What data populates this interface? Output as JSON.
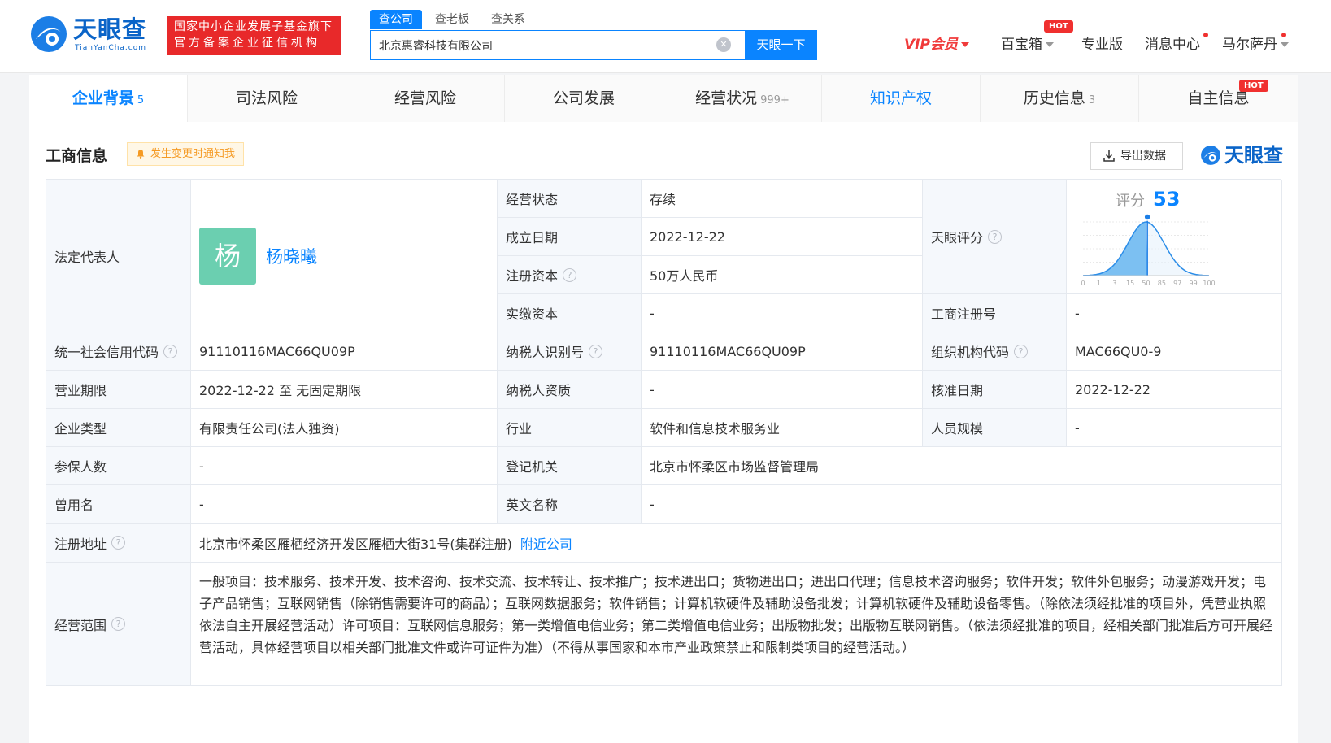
{
  "header": {
    "logo_name": "天眼查",
    "logo_domain": "TianYanCha.com",
    "gov_line1": "国家中小企业发展子基金旗下",
    "gov_line2": "官方备案企业征信机构",
    "search_tabs": [
      "查公司",
      "查老板",
      "查关系"
    ],
    "search_value": "北京惠睿科技有限公司",
    "search_button": "天眼一下",
    "vip": "VIP会员",
    "toolbox": "百宝箱",
    "hot": "HOT",
    "pro": "专业版",
    "messages": "消息中心",
    "user": "马尔萨丹"
  },
  "tabs": [
    {
      "label": "企业背景",
      "count": "5"
    },
    {
      "label": "司法风险",
      "count": ""
    },
    {
      "label": "经营风险",
      "count": ""
    },
    {
      "label": "公司发展",
      "count": ""
    },
    {
      "label": "经营状况",
      "count": "999+"
    },
    {
      "label": "知识产权",
      "count": ""
    },
    {
      "label": "历史信息",
      "count": "3"
    },
    {
      "label": "自主信息",
      "count": ""
    }
  ],
  "section": {
    "title": "工商信息",
    "notify": "发生变更时通知我",
    "export": "导出数据",
    "brand": "天眼查"
  },
  "info": {
    "legal_rep_label": "法定代表人",
    "legal_rep_avatar": "杨",
    "legal_rep_name": "杨晓曦",
    "status_label": "经营状态",
    "status": "存续",
    "found_label": "成立日期",
    "found": "2022-12-22",
    "reg_capital_label": "注册资本",
    "reg_capital": "50万人民币",
    "paid_capital_label": "实缴资本",
    "paid_capital": "-",
    "score_label": "天眼评分",
    "score_title": "评分",
    "score_value": "53",
    "score_value_num": 53,
    "score_ticks": [
      "0",
      "1",
      "3",
      "15",
      "50",
      "85",
      "97",
      "99",
      "100"
    ],
    "reg_no_label": "工商注册号",
    "reg_no": "-",
    "credit_code_label": "统一社会信用代码",
    "credit_code": "91110116MAC66QU09P",
    "taxpayer_id_label": "纳税人识别号",
    "taxpayer_id": "91110116MAC66QU09P",
    "org_code_label": "组织机构代码",
    "org_code": "MAC66QU0-9",
    "term_label": "营业期限",
    "term": "2022-12-22 至 无固定期限",
    "taxpayer_qual_label": "纳税人资质",
    "taxpayer_qual": "-",
    "approve_label": "核准日期",
    "approve": "2022-12-22",
    "type_label": "企业类型",
    "type": "有限责任公司(法人独资)",
    "industry_label": "行业",
    "industry": "软件和信息技术服务业",
    "staff_label": "人员规模",
    "staff": "-",
    "insured_label": "参保人数",
    "insured": "-",
    "authority_label": "登记机关",
    "authority": "北京市怀柔区市场监督管理局",
    "former_label": "曾用名",
    "former": "-",
    "english_label": "英文名称",
    "english": "-",
    "address_label": "注册地址",
    "address": "北京市怀柔区雁栖经济开发区雁栖大街31号(集群注册)",
    "nearby": "附近公司",
    "scope_label": "经营范围",
    "scope": "一般项目：技术服务、技术开发、技术咨询、技术交流、技术转让、技术推广；技术进出口；货物进出口；进出口代理；信息技术咨询服务；软件开发；软件外包服务；动漫游戏开发；电子产品销售；互联网销售（除销售需要许可的商品）；互联网数据服务；软件销售；计算机软硬件及辅助设备批发；计算机软硬件及辅助设备零售。（除依法须经批准的项目外，凭营业执照依法自主开展经营活动）许可项目：互联网信息服务；第一类增值电信业务；第二类增值电信业务；出版物批发；出版物互联网销售。（依法须经批准的项目，经相关部门批准后方可开展经营活动，具体经营项目以相关部门批准文件或许可证件为准）（不得从事国家和本市产业政策禁止和限制类项目的经营活动。）"
  },
  "colors": {
    "brand_blue": "#0a84ff",
    "red": "#e8292a",
    "avatar_green": "#6bcfb0"
  }
}
